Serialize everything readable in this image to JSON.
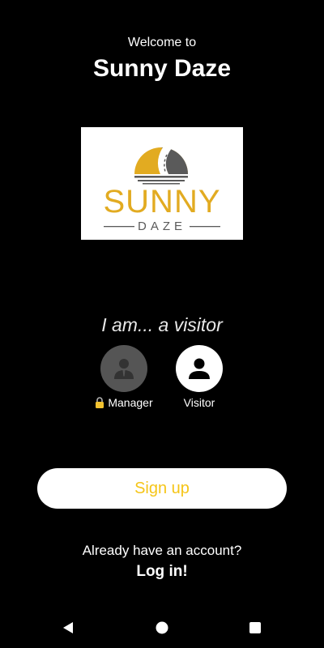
{
  "header": {
    "welcome_line": "Welcome to",
    "app_name": "Sunny Daze"
  },
  "logo": {
    "word_main": "SUNNY",
    "word_sub": "DAZE",
    "brand_color": "#e2ab21",
    "icon": "sunset-road-icon"
  },
  "role_picker": {
    "caption": "I am... a visitor",
    "options": [
      {
        "label": "Manager",
        "locked": true,
        "icon": "manager-avatar-icon",
        "selected": false
      },
      {
        "label": "Visitor",
        "locked": false,
        "icon": "person-icon",
        "selected": true
      }
    ]
  },
  "actions": {
    "signup_label": "Sign up",
    "signup_text_color": "#f5c518",
    "account_prompt": "Already have an account?",
    "login_label": "Log in!"
  },
  "nav_bar": {
    "items": [
      "back-icon",
      "home-icon",
      "recents-icon"
    ]
  }
}
